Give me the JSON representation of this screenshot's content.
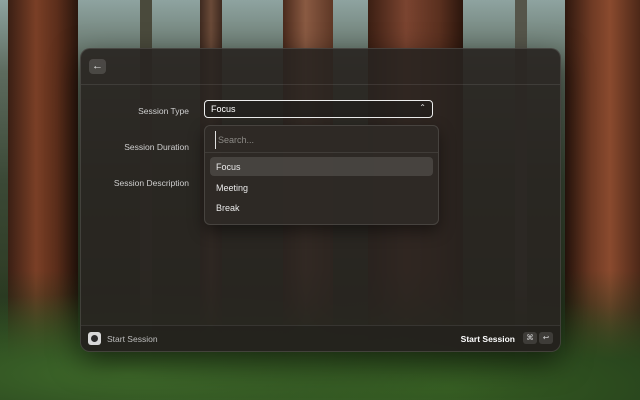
{
  "form": {
    "session_type_label": "Session Type",
    "session_duration_label": "Session Duration",
    "session_description_label": "Session Description",
    "session_type_value": "Focus"
  },
  "dropdown": {
    "search_placeholder": "Search...",
    "options": [
      "Focus",
      "Meeting",
      "Break"
    ],
    "selected_index": 0
  },
  "footer": {
    "title": "Start Session",
    "action_label": "Start Session",
    "shortcut_cmd": "⌘",
    "shortcut_return": "↩"
  },
  "icons": {
    "back": "arrow-left-icon",
    "select_chevron": "chevron-up-icon",
    "app": "app-icon"
  }
}
